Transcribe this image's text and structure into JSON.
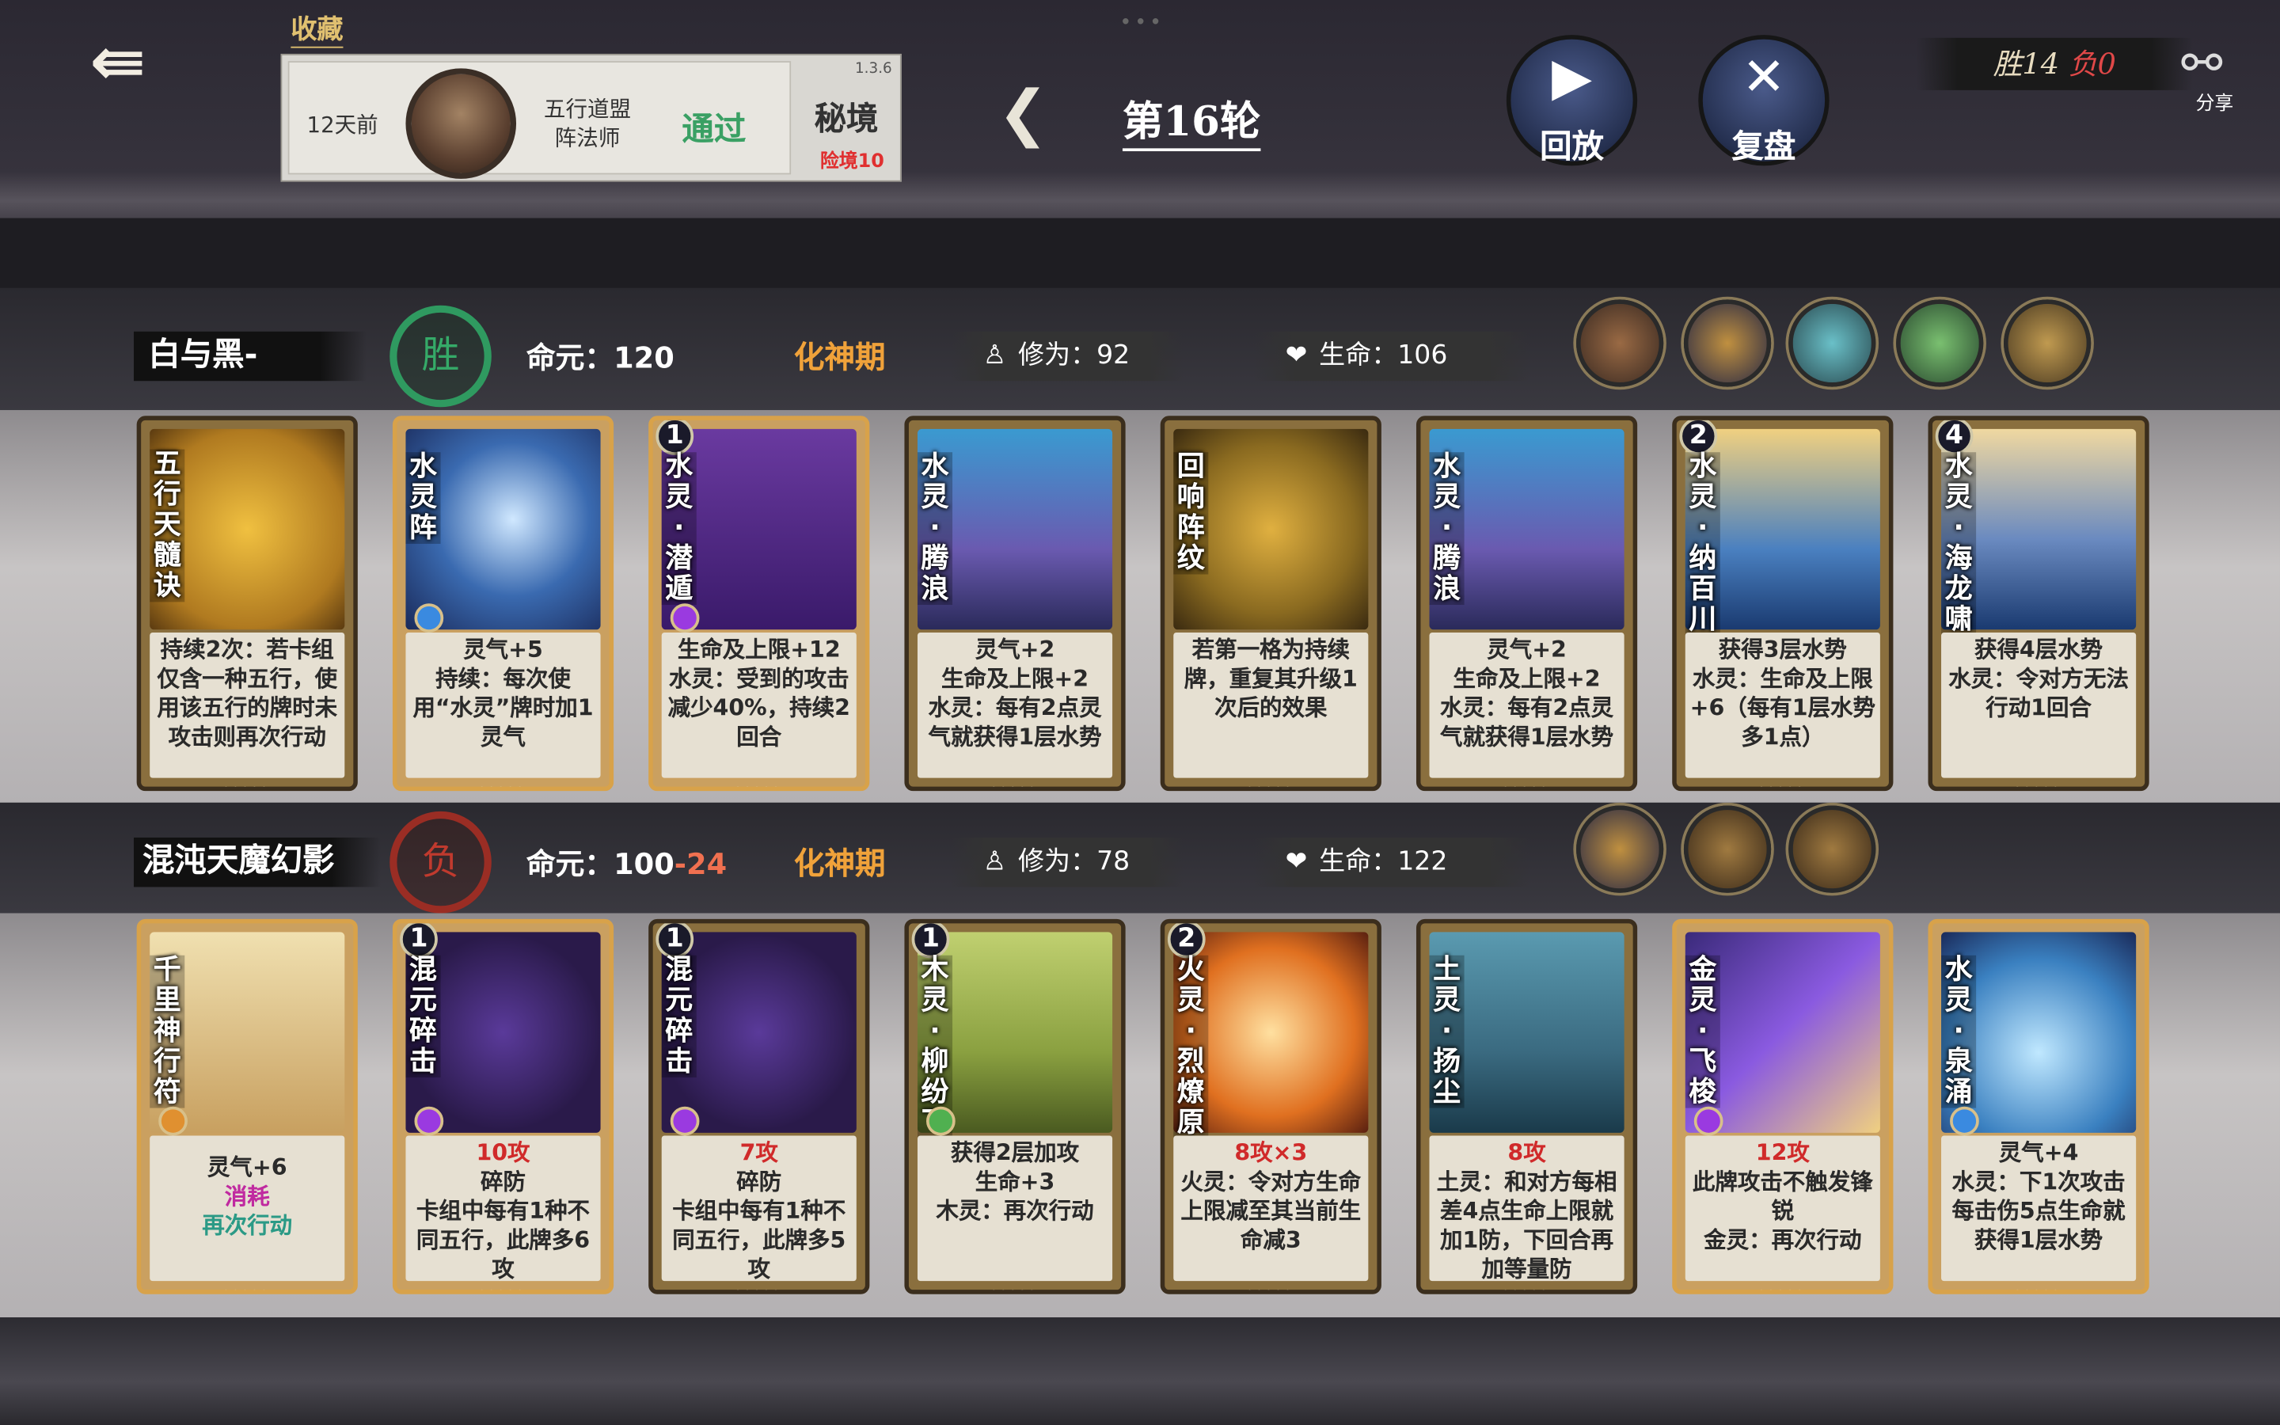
{
  "header": {
    "back_icon": "back-arrow-icon",
    "favorite_label": "收藏",
    "record": {
      "time": "12天前",
      "opponent": "五行道盟阵法师",
      "opponent_line1": "五行道盟",
      "opponent_line2": "阵法师",
      "result": "通过",
      "version": "1.3.6",
      "mode": "秘境",
      "difficulty": "险境10"
    },
    "round_label": "第16轮",
    "replay_label": "回放",
    "review_label": "复盘",
    "score": {
      "win_label": "胜14",
      "lose_label": "负0"
    },
    "share_label": "分享"
  },
  "players": [
    {
      "name": "白与黑-",
      "result": "胜",
      "destiny_label": "命元：",
      "destiny_value": "120",
      "destiny_loss": "",
      "realm": "化神期",
      "cultivation_label": "修为：",
      "cultivation_value": "92",
      "hp_label": "生命：",
      "hp_value": "106",
      "relics": [
        "relic-1",
        "relic-2",
        "relic-3",
        "relic-4",
        "relic-5"
      ],
      "cards": [
        {
          "name": "五行天髓诀",
          "level": "",
          "desc": [
            "持续2次：若卡组仅含一种五行，使用该五行的牌时未攻击则再次行动"
          ]
        },
        {
          "name": "水灵阵",
          "level": "",
          "desc": [
            "灵气+5",
            "持续：每次使用“水灵”牌时加1灵气"
          ]
        },
        {
          "name": "水灵·潜遁",
          "level": "1",
          "desc": [
            "生命及上限+12",
            "水灵：受到的攻击减少40%，持续2回合"
          ]
        },
        {
          "name": "水灵·腾浪",
          "level": "",
          "desc": [
            "灵气+2",
            "生命及上限+2",
            "水灵：每有2点灵气就获得1层水势"
          ]
        },
        {
          "name": "回响阵纹",
          "level": "",
          "desc": [
            "若第一格为持续牌，重复其升级1次后的效果"
          ]
        },
        {
          "name": "水灵·腾浪",
          "level": "",
          "desc": [
            "灵气+2",
            "生命及上限+2",
            "水灵：每有2点灵气就获得1层水势"
          ]
        },
        {
          "name": "水灵·纳百川",
          "level": "2",
          "desc": [
            "获得3层水势",
            "水灵：生命及上限+6（每有1层水势多1点）"
          ]
        },
        {
          "name": "水灵·海龙啸",
          "level": "4",
          "desc": [
            "获得4层水势",
            "水灵：令对方无法行动1回合"
          ]
        }
      ]
    },
    {
      "name": "混沌天魔幻影",
      "result": "负",
      "destiny_label": "命元：",
      "destiny_value": "100",
      "destiny_loss": "-24",
      "realm": "化神期",
      "cultivation_label": "修为：",
      "cultivation_value": "78",
      "hp_label": "生命：",
      "hp_value": "122",
      "relics": [
        "relic-1",
        "relic-2",
        "relic-3"
      ],
      "cards": [
        {
          "name": "千里神行符",
          "level": "",
          "desc": [
            "灵气+6",
            "消耗",
            "再次行动"
          ]
        },
        {
          "name": "混元碎击",
          "level": "1",
          "desc": [
            "10攻",
            "碎防",
            "卡组中每有1种不同五行，此牌多6攻"
          ]
        },
        {
          "name": "混元碎击",
          "level": "1",
          "desc": [
            "7攻",
            "碎防",
            "卡组中每有1种不同五行，此牌多5攻"
          ]
        },
        {
          "name": "木灵·柳纷飞",
          "level": "1",
          "desc": [
            "获得2层加攻",
            "生命+3",
            "木灵：再次行动"
          ]
        },
        {
          "name": "火灵·烈燎原",
          "level": "2",
          "desc": [
            "8攻×3",
            "火灵：令对方生命上限减至其当前生命减3"
          ]
        },
        {
          "name": "土灵·扬尘",
          "level": "",
          "desc": [
            "8攻",
            "土灵：和对方每相差4点生命上限就加1防，下回合再加等量防"
          ]
        },
        {
          "name": "金灵·飞梭",
          "level": "",
          "desc": [
            "12攻",
            "此牌攻击不触发锋锐",
            "金灵：再次行动"
          ]
        },
        {
          "name": "水灵·泉涌",
          "level": "",
          "desc": [
            "灵气+4",
            "水灵：下1次攻击每击伤5点生命就获得1层水势"
          ]
        }
      ]
    }
  ],
  "colors": {
    "win": "#35aa68",
    "lose": "#c03a2e",
    "realm": "#f0a23a",
    "accent": "#2b9a86"
  }
}
